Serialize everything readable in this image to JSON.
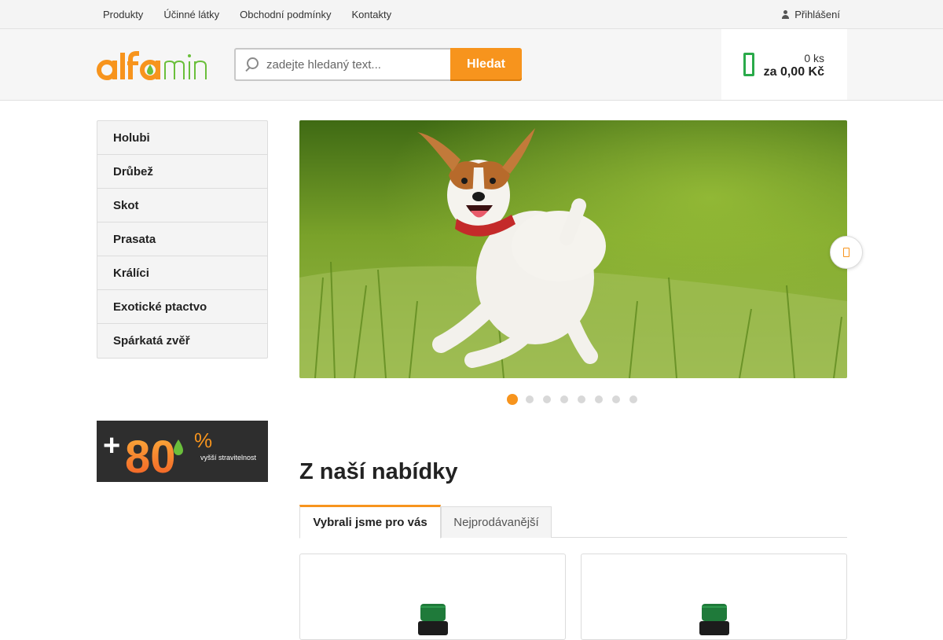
{
  "topnav": {
    "items": [
      "Produkty",
      "Účinné látky",
      "Obchodní podmínky",
      "Kontakty"
    ],
    "login_label": "Přihlášení"
  },
  "header": {
    "logo_text": "alfamin",
    "search": {
      "placeholder": "zadejte hledaný text...",
      "button_label": "Hledat"
    },
    "cart": {
      "count": "0 ks",
      "total": "za 0,00 Kč"
    }
  },
  "sidebar": {
    "items": [
      "Holubi",
      "Drůbež",
      "Skot",
      "Prasata",
      "Králíci",
      "Exotické ptactvo",
      "Spárkatá zvěř"
    ],
    "promo": {
      "big": "+80",
      "percent": "%",
      "caption": "vyšší stravitelnost"
    }
  },
  "slider": {
    "slide_count": 8,
    "active_index": 0,
    "icon": "chevron-right-icon"
  },
  "offer": {
    "title": "Z naší nabídky",
    "tabs": [
      "Vybrali jsme pro vás",
      "Nejprodávanější"
    ]
  },
  "colors": {
    "accent": "#f7941d",
    "green": "#2aaa4a",
    "dark": "#2e2e2e"
  }
}
